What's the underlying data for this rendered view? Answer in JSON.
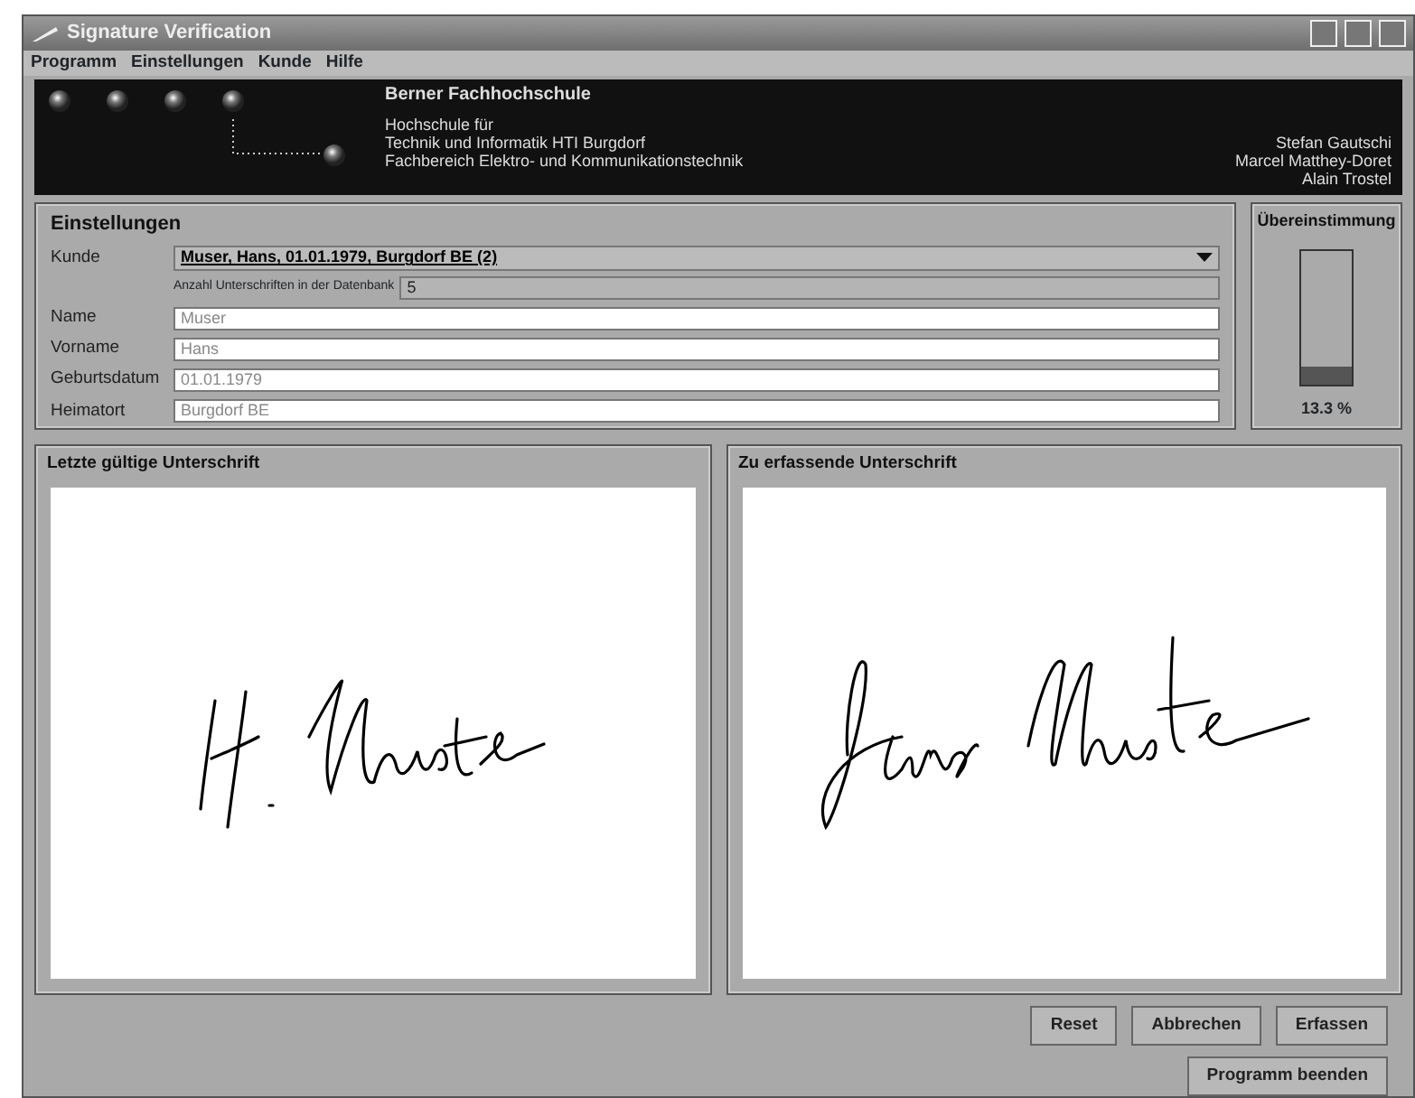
{
  "window": {
    "title": "Signature Verification"
  },
  "menu": [
    "Programm",
    "Einstellungen",
    "Kunde",
    "Hilfe"
  ],
  "banner": {
    "school": "Berner Fachhochschule",
    "lines": [
      "Hochschule für",
      "Technik und Informatik HTI Burgdorf",
      "Fachbereich Elektro- und Kommunikationstechnik"
    ],
    "authors": [
      "Stefan Gautschi",
      "Marcel Matthey-Doret",
      "Alain Trostel"
    ]
  },
  "settings": {
    "title": "Einstellungen",
    "customer_label": "Kunde",
    "customer": "Muser, Hans, 01.01.1979, Burgdorf BE  (2)",
    "count_label": "Anzahl Unterschriften in der Datenbank",
    "count": "5",
    "fields": [
      {
        "label": "Name",
        "value": "Muser"
      },
      {
        "label": "Vorname",
        "value": "Hans"
      },
      {
        "label": "Geburtsdatum",
        "value": "01.01.1979"
      },
      {
        "label": "Heimatort",
        "value": "Burgdorf BE"
      }
    ]
  },
  "match": {
    "title": "Übereinstimmung",
    "level": 0.133,
    "reading": "13.3 %"
  },
  "panels": [
    {
      "title": "Letzte gültige Unterschrift"
    },
    {
      "title": "Zu erfassende Unterschrift"
    }
  ],
  "buttons": [
    "Reset",
    "Abbrechen",
    "Erfassen"
  ],
  "exit_button": "Programm beenden"
}
